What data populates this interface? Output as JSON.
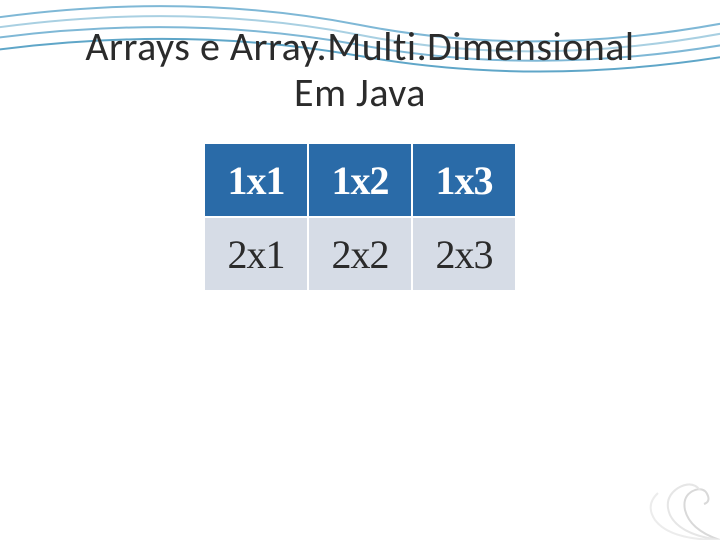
{
  "title_line1": "Arrays e Array.Multi.Dimensional",
  "title_line2": "Em Java",
  "table": {
    "rows": [
      {
        "cells": [
          "1x1",
          "1x2",
          "1x3"
        ]
      },
      {
        "cells": [
          "2x1",
          "2x2",
          "2x3"
        ]
      }
    ]
  },
  "colors": {
    "header_bg": "#2a6ba8",
    "header_fg": "#ffffff",
    "row_bg": "#d6dce6",
    "row_fg": "#2b2b2b",
    "wave_stroke": "#7fb8d6"
  }
}
